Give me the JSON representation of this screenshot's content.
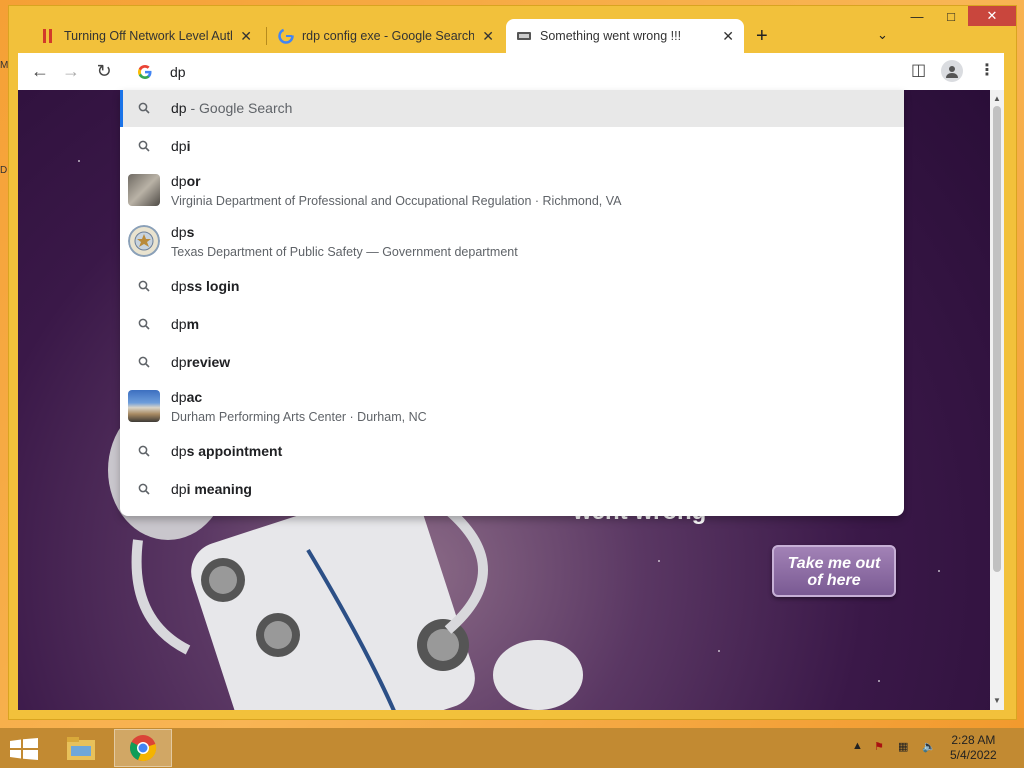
{
  "window": {
    "tabs": [
      {
        "title": "Turning Off Network Level Authe",
        "favicon": "red-bars-icon"
      },
      {
        "title": "rdp config exe - Google Search",
        "favicon": "google-g-icon"
      },
      {
        "title": "Something went wrong !!!",
        "favicon": "site-icon"
      }
    ],
    "new_tab_label": "+",
    "close_tab_label": "✕"
  },
  "omnibox": {
    "value": "dp",
    "search_engine_icon": "google-g-icon"
  },
  "suggestions": [
    {
      "prefix": "dp",
      "bold": "",
      "hint": " - Google Search",
      "icon": "search-icon",
      "selected": true
    },
    {
      "prefix": "dp",
      "bold": "i",
      "icon": "search-icon"
    },
    {
      "prefix": "dp",
      "bold": "or",
      "sub": "Virginia Department of Professional and Occupational Regulation · Richmond, VA",
      "icon": "thumbnail"
    },
    {
      "prefix": "dp",
      "bold": "s",
      "sub": "Texas Department of Public Safety — Government department",
      "icon": "seal-thumbnail"
    },
    {
      "prefix": "dp",
      "bold": "ss login",
      "icon": "search-icon"
    },
    {
      "prefix": "dp",
      "bold": "m",
      "icon": "search-icon"
    },
    {
      "prefix": "dp",
      "bold": "review",
      "icon": "search-icon"
    },
    {
      "prefix": "dp",
      "bold": "ac",
      "sub": "Durham Performing Arts Center · Durham, NC",
      "icon": "building-thumbnail"
    },
    {
      "prefix": "dp",
      "bold": "s appointment",
      "icon": "search-icon"
    },
    {
      "prefix": "dp",
      "bold": "i meaning",
      "icon": "search-icon"
    }
  ],
  "page": {
    "heading_partial": "went wrong",
    "cta_line1": "Take me out",
    "cta_line2": "of here"
  },
  "taskbar": {
    "time": "2:28 AM",
    "date": "5/4/2022"
  },
  "desktop": {
    "letters": [
      "M",
      "D"
    ]
  }
}
